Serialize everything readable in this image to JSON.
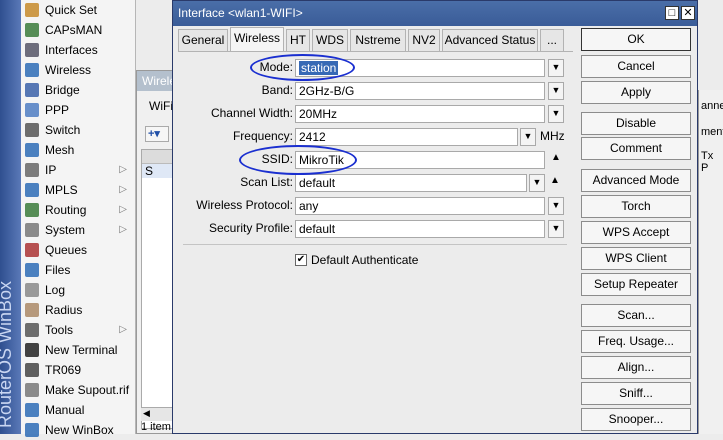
{
  "sidebar": {
    "brand": "RouterOS WinBox",
    "items": [
      {
        "label": "Quick Set",
        "icon": "quick-set-icon",
        "sub": false
      },
      {
        "label": "CAPsMAN",
        "icon": "capsman-icon",
        "sub": false
      },
      {
        "label": "Interfaces",
        "icon": "interfaces-icon",
        "sub": false
      },
      {
        "label": "Wireless",
        "icon": "wireless-icon",
        "sub": false
      },
      {
        "label": "Bridge",
        "icon": "bridge-icon",
        "sub": false
      },
      {
        "label": "PPP",
        "icon": "ppp-icon",
        "sub": false
      },
      {
        "label": "Switch",
        "icon": "switch-icon",
        "sub": false
      },
      {
        "label": "Mesh",
        "icon": "mesh-icon",
        "sub": false
      },
      {
        "label": "IP",
        "icon": "ip-icon",
        "sub": true
      },
      {
        "label": "MPLS",
        "icon": "mpls-icon",
        "sub": true
      },
      {
        "label": "Routing",
        "icon": "routing-icon",
        "sub": true
      },
      {
        "label": "System",
        "icon": "system-icon",
        "sub": true
      },
      {
        "label": "Queues",
        "icon": "queues-icon",
        "sub": false
      },
      {
        "label": "Files",
        "icon": "files-icon",
        "sub": false
      },
      {
        "label": "Log",
        "icon": "log-icon",
        "sub": false
      },
      {
        "label": "Radius",
        "icon": "radius-icon",
        "sub": false
      },
      {
        "label": "Tools",
        "icon": "tools-icon",
        "sub": true
      },
      {
        "label": "New Terminal",
        "icon": "terminal-icon",
        "sub": false
      },
      {
        "label": "TR069",
        "icon": "tr069-icon",
        "sub": false
      },
      {
        "label": "Make Supout.rif",
        "icon": "supout-icon",
        "sub": false
      },
      {
        "label": "Manual",
        "icon": "manual-icon",
        "sub": false
      },
      {
        "label": "New WinBox",
        "icon": "winbox-icon",
        "sub": false
      }
    ]
  },
  "bg_window": {
    "title": "Wirele",
    "tab": "WiFi",
    "row_flag": "S",
    "status": "1 item",
    "right_text1": "anne",
    "right_text2": "ment",
    "right_text3": "Tx P"
  },
  "dialog": {
    "title": "Interface <wlan1-WIFI>",
    "tabs": [
      "General",
      "Wireless",
      "HT",
      "WDS",
      "Nstreme",
      "NV2",
      "Advanced Status",
      "..."
    ],
    "active_tab": "Wireless",
    "fields": {
      "mode": {
        "label": "Mode:",
        "value": "station"
      },
      "band": {
        "label": "Band:",
        "value": "2GHz-B/G"
      },
      "channel_width": {
        "label": "Channel Width:",
        "value": "20MHz"
      },
      "frequency": {
        "label": "Frequency:",
        "value": "2412",
        "unit": "MHz"
      },
      "ssid": {
        "label": "SSID:",
        "value": "MikroTik"
      },
      "scan_list": {
        "label": "Scan List:",
        "value": "default"
      },
      "wireless_protocol": {
        "label": "Wireless Protocol:",
        "value": "any"
      },
      "security_profile": {
        "label": "Security Profile:",
        "value": "default"
      }
    },
    "default_authenticate": {
      "label": "Default Authenticate",
      "checked": true
    },
    "buttons": [
      "OK",
      "Cancel",
      "Apply",
      "Disable",
      "Comment",
      "Advanced Mode",
      "Torch",
      "WPS Accept",
      "WPS Client",
      "Setup Repeater",
      "Scan...",
      "Freq. Usage...",
      "Align...",
      "Sniff...",
      "Snooper..."
    ]
  },
  "colors": {
    "annotation": "#1a2fd0",
    "title_bar": "#3a5c98",
    "selection": "#3769b5"
  }
}
